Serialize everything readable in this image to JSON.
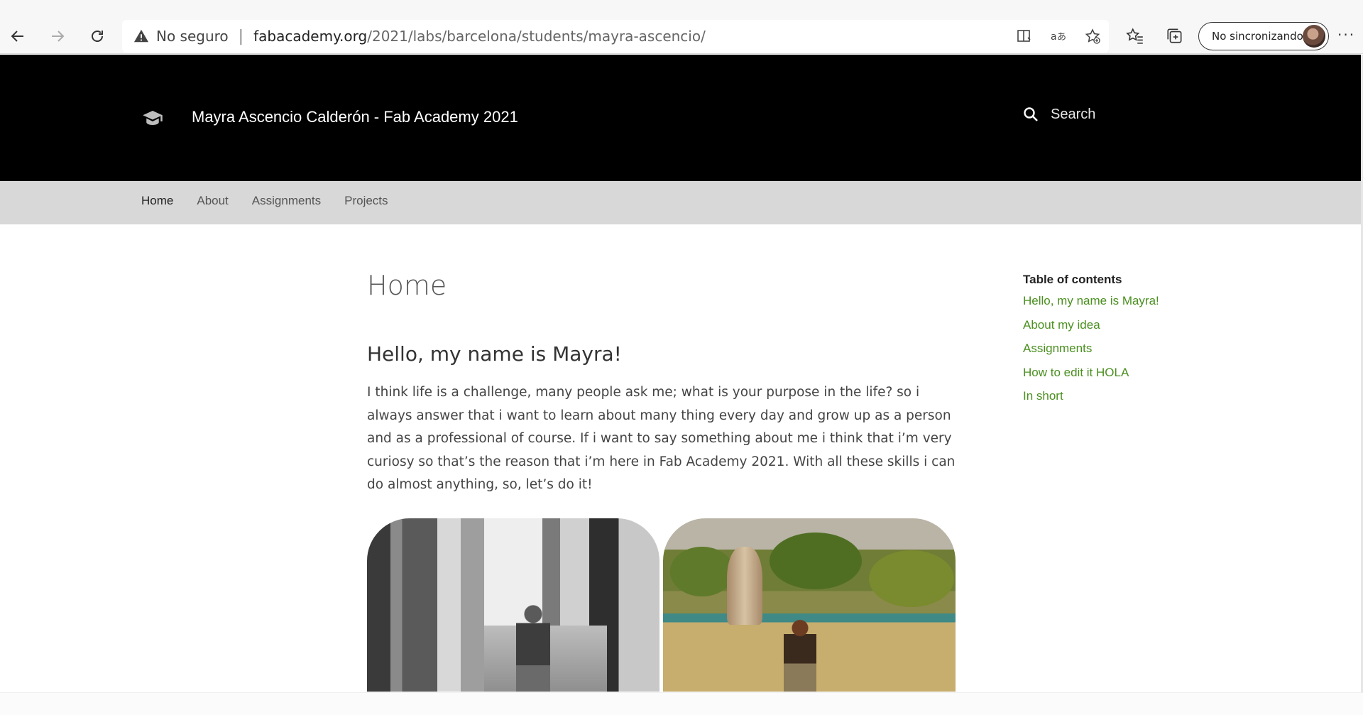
{
  "browser": {
    "security_label": "No seguro",
    "url_host": "fabacademy.org",
    "url_path": "/2021/labs/barcelona/students/mayra-ascencio/",
    "sync_label": "No sincronizando",
    "more_label": "···"
  },
  "site": {
    "title": "Mayra Ascencio Calderón - Fab Academy 2021",
    "search_label": "Search"
  },
  "tabs": [
    {
      "label": "Home",
      "active": true
    },
    {
      "label": "About",
      "active": false
    },
    {
      "label": "Assignments",
      "active": false
    },
    {
      "label": "Projects",
      "active": false
    }
  ],
  "main": {
    "page_title": "Home",
    "heading": "Hello, my name is Mayra!",
    "paragraph": "I think life is a challenge, many people ask me; what is your purpose in the life? so i always answer that i want to learn about many thing every day and grow up as a person and as a professional of course. If i want to say something about me i think that i’m very curiosy so that’s the reason that i’m here in Fab Academy 2021. With all these skills i can do almost anything, so, let’s do it!"
  },
  "toc": {
    "title": "Table of contents",
    "items": [
      "Hello, my name is Mayra!",
      "About my idea",
      "Assignments",
      "How to edit it HOLA",
      "In short"
    ]
  },
  "colors": {
    "header_bg": "#000000",
    "tabs_bg": "#d8d8d8",
    "toc_link": "#4a8f1f"
  }
}
